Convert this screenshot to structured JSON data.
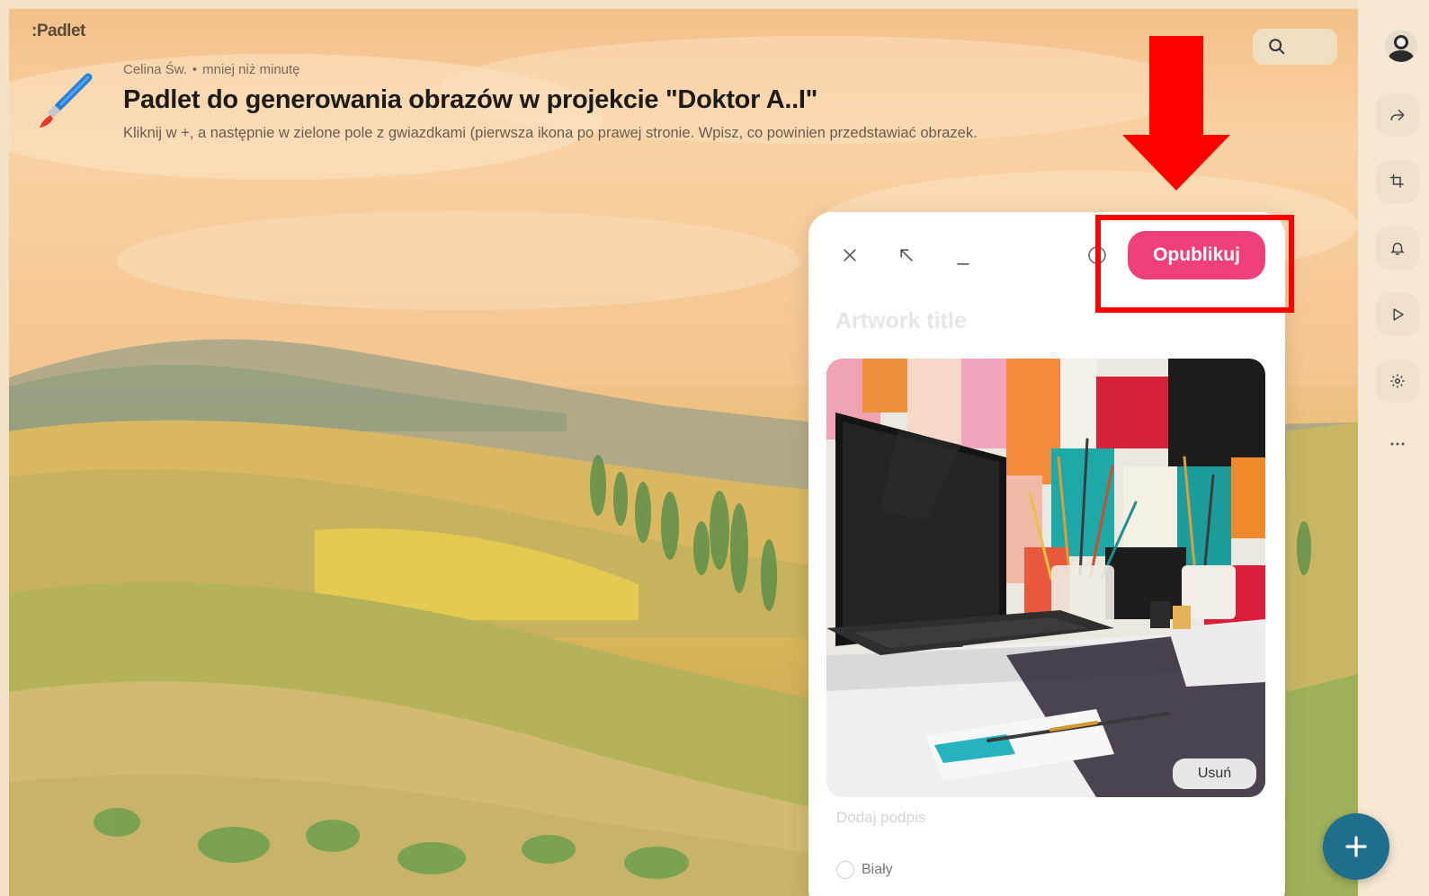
{
  "app": {
    "brand": ":Padlet"
  },
  "header": {
    "author": "Celina Św.",
    "timestamp": "mniej niż minutę",
    "title": "Padlet do generowania obrazów w projekcie \"Doktor A..I\"",
    "description": "Kliknij w +, a następnie w zielone pole z gwiazdkami (pierwsza ikona po prawej stronie. Wpisz, co powinien przedstawiać obrazek."
  },
  "composer": {
    "publish_label": "Opublikuj",
    "title_placeholder": "Artwork title",
    "remove_label": "Usuń",
    "caption_placeholder": "Dodaj podpis",
    "color_option": "Biały"
  },
  "icons": {
    "close": "close-icon",
    "expand": "expand-arrow-icon",
    "minimize": "minimize-icon",
    "schedule": "clock-icon",
    "search": "search-icon",
    "share": "share-icon",
    "remake": "remake-icon",
    "notifications": "bell-icon",
    "slideshow": "play-icon",
    "settings": "gear-icon",
    "more": "more-icon",
    "add": "plus-icon"
  },
  "colors": {
    "publish": "#f0407a",
    "fab": "#1f6e8c",
    "annotation": "#ff0000"
  }
}
